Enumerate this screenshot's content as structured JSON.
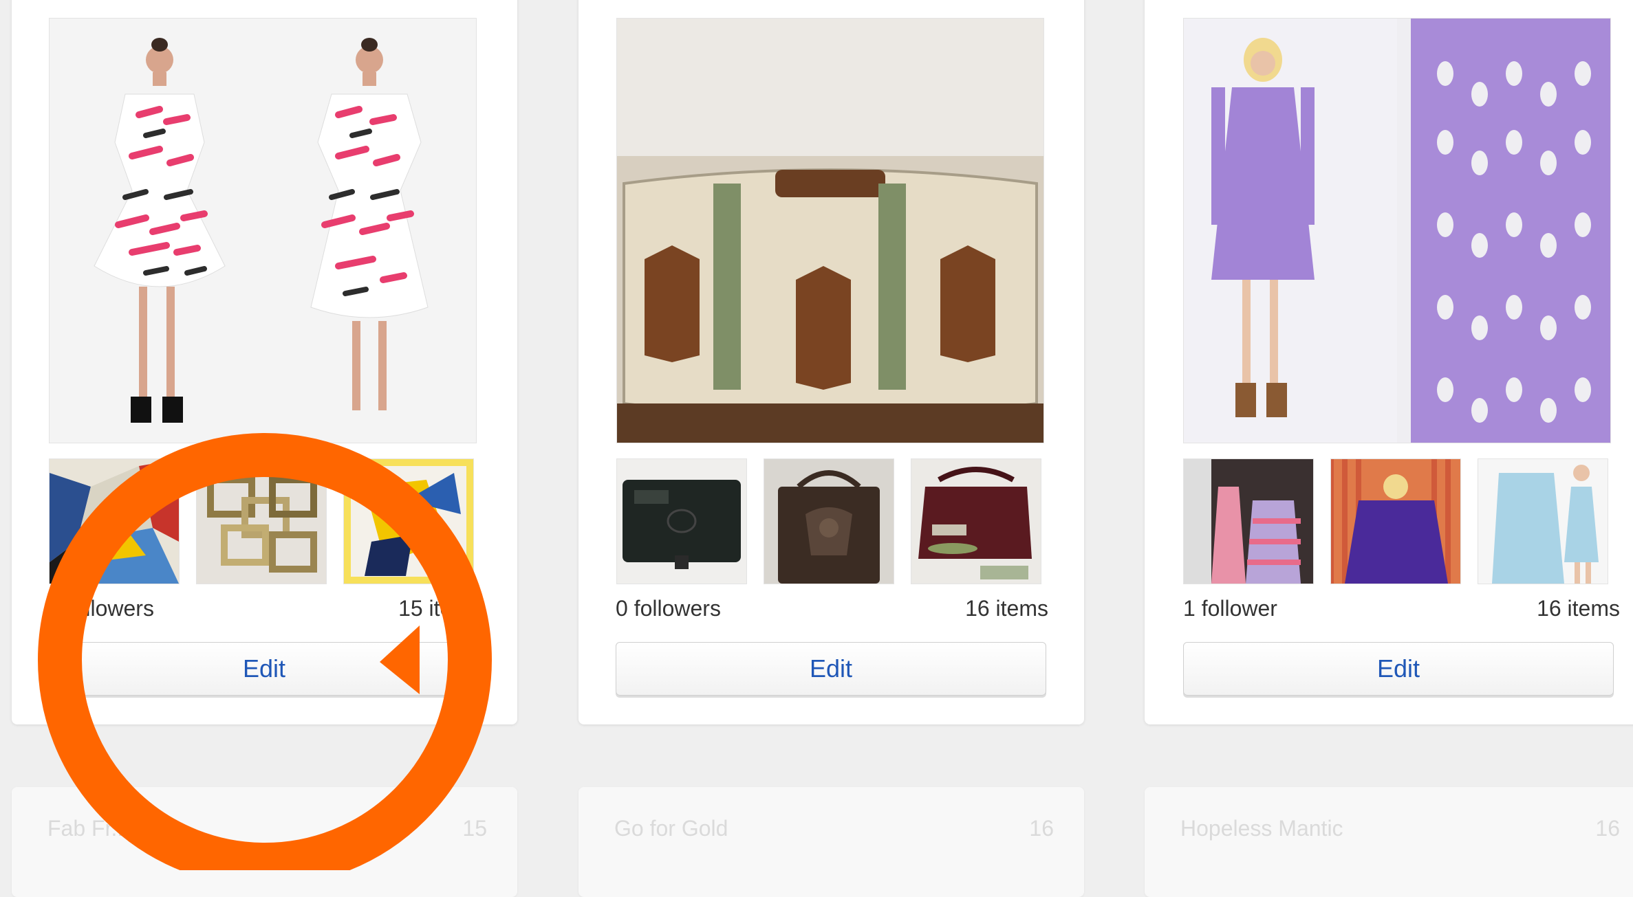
{
  "cards": [
    {
      "followers": "0 followers",
      "items": "15 items",
      "edit_label": "Edit",
      "images": {
        "main": "pink-black-scribble-print-dress-photo",
        "thumbs": [
          "abstract-geometric-print-photo",
          "linked-buckle-belt-photo",
          "yellow-blue-print-scarf-photo"
        ]
      }
    },
    {
      "followers": "0 followers",
      "items": "16 items",
      "edit_label": "Edit",
      "images": {
        "main": "canvas-leather-strap-bag-photo",
        "thumbs": [
          "black-leather-wallet-photo",
          "tooled-leather-handbag-photo",
          "burgundy-leather-bag-photo"
        ]
      }
    },
    {
      "followers": "1 follower",
      "items": "16 items",
      "edit_label": "Edit",
      "images": {
        "main": "purple-crochet-dress-photo",
        "thumbs": [
          "pink-chevron-dress-photo",
          "purple-kaftan-photo",
          "light-blue-dress-photo"
        ]
      }
    }
  ],
  "lower_cards": [
    {
      "title": "Fab Fr...",
      "count": "15"
    },
    {
      "title": "Go for Gold",
      "count": "16"
    },
    {
      "title": "Hopeless Mantic",
      "count": "16"
    }
  ],
  "annotation": {
    "shape": "highlight-circle-with-arrow",
    "color": "#ff6600",
    "target": "first card edit button"
  }
}
